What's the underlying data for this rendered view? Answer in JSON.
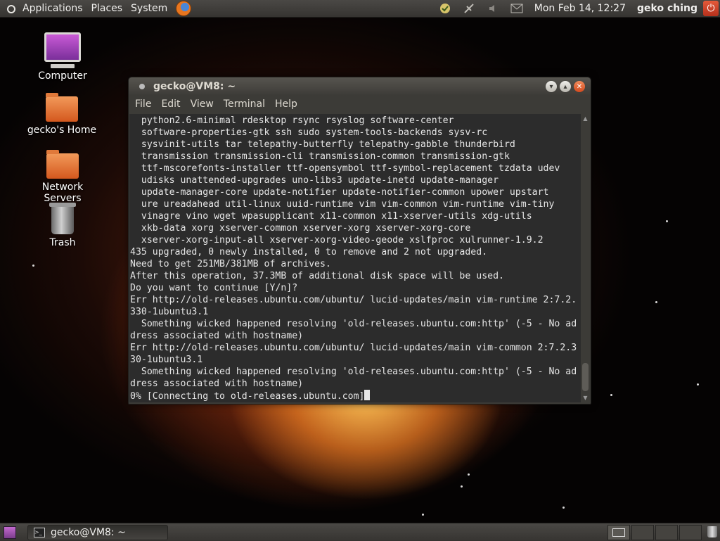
{
  "top_panel": {
    "menus": [
      "Applications",
      "Places",
      "System"
    ],
    "clock": "Mon Feb 14, 12:27",
    "username": "geko ching",
    "tray_icons": [
      "update-notifier-icon",
      "network-disconnected-icon",
      "volume-icon",
      "mail-icon"
    ]
  },
  "desktop_icons": [
    {
      "label": "Computer",
      "icon": "computer-icon"
    },
    {
      "label": "gecko's Home",
      "icon": "home-folder-icon"
    },
    {
      "label": "Network Servers",
      "icon": "network-folder-icon"
    },
    {
      "label": "Trash",
      "icon": "trash-icon"
    }
  ],
  "terminal": {
    "title": "gecko@VM8: ~",
    "menu": [
      "File",
      "Edit",
      "View",
      "Terminal",
      "Help"
    ],
    "lines": [
      "  python2.6-minimal rdesktop rsync rsyslog software-center",
      "  software-properties-gtk ssh sudo system-tools-backends sysv-rc",
      "  sysvinit-utils tar telepathy-butterfly telepathy-gabble thunderbird",
      "  transmission transmission-cli transmission-common transmission-gtk",
      "  ttf-mscorefonts-installer ttf-opensymbol ttf-symbol-replacement tzdata udev",
      "  udisks unattended-upgrades uno-libs3 update-inetd update-manager",
      "  update-manager-core update-notifier update-notifier-common upower upstart",
      "  ure ureadahead util-linux uuid-runtime vim vim-common vim-runtime vim-tiny",
      "  vinagre vino wget wpasupplicant x11-common x11-xserver-utils xdg-utils",
      "  xkb-data xorg xserver-common xserver-xorg xserver-xorg-core",
      "  xserver-xorg-input-all xserver-xorg-video-geode xslfproc xulrunner-1.9.2",
      "435 upgraded, 0 newly installed, 0 to remove and 2 not upgraded.",
      "Need to get 251MB/381MB of archives.",
      "After this operation, 37.3MB of additional disk space will be used.",
      "Do you want to continue [Y/n]?",
      "Err http://old-releases.ubuntu.com/ubuntu/ lucid-updates/main vim-runtime 2:7.2.",
      "330-1ubuntu3.1",
      "  Something wicked happened resolving 'old-releases.ubuntu.com:http' (-5 - No ad",
      "dress associated with hostname)",
      "Err http://old-releases.ubuntu.com/ubuntu/ lucid-updates/main vim-common 2:7.2.3",
      "30-1ubuntu3.1",
      "  Something wicked happened resolving 'old-releases.ubuntu.com:http' (-5 - No ad",
      "dress associated with hostname)"
    ],
    "prompt_line": "0% [Connecting to old-releases.ubuntu.com]"
  },
  "bottom_panel": {
    "task_label": "gecko@VM8: ~"
  }
}
